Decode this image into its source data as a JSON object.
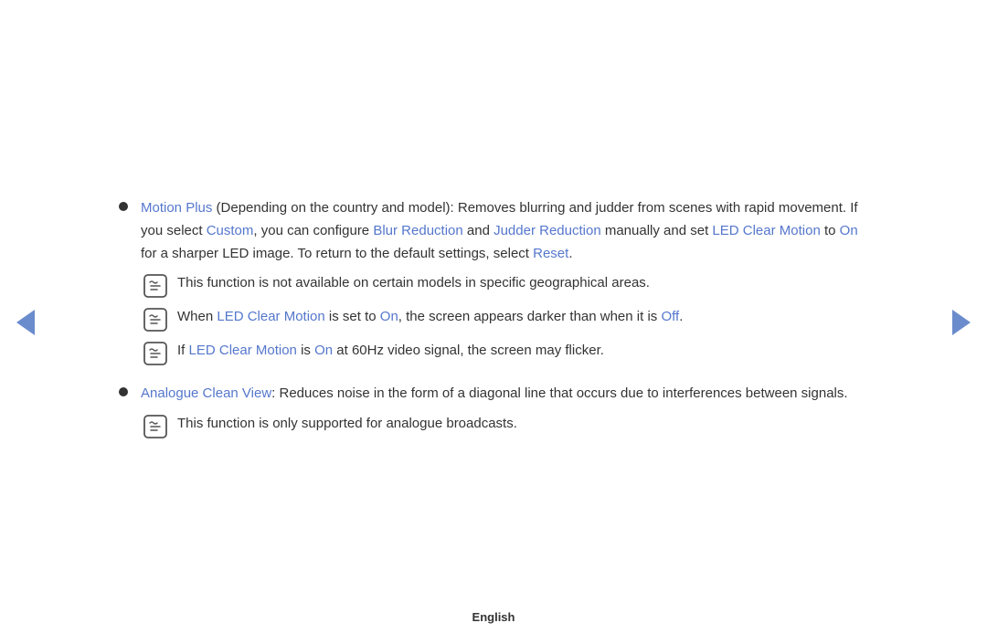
{
  "colors": {
    "link": "#5577cc",
    "text": "#333333",
    "bullet": "#333333",
    "arrow": "#6b8ccc"
  },
  "content": {
    "bullet1": {
      "term": "Motion Plus",
      "term_suffix": " (Depending on the country and model): Removes blurring and judder from scenes with rapid movement. If you select ",
      "custom": "Custom",
      "custom_suffix": ", you can configure ",
      "blur": "Blur Reduction",
      "and": " and ",
      "judder": "Judder Reduction",
      "manually": " manually and set ",
      "led": "LED Clear Motion",
      "to": " to ",
      "on": "On",
      "on_suffix": " for a sharper LED image. To return to the default settings, select ",
      "reset": "Reset",
      "reset_suffix": ".",
      "notes": [
        {
          "text": "This function is not available on certain models in specific geographical areas."
        },
        {
          "text_before": "When ",
          "led": "LED Clear Motion",
          "text_mid": " is set to ",
          "on": "On",
          "text_after": ", the screen appears darker than when it is ",
          "off": "Off",
          "text_end": "."
        },
        {
          "text_before": "If ",
          "led": "LED Clear Motion",
          "text_mid": " is ",
          "on": "On",
          "text_after": " at 60Hz video signal, the screen may flicker."
        }
      ]
    },
    "bullet2": {
      "term": "Analogue Clean View",
      "term_suffix": ": Reduces noise in the form of a diagonal line that occurs due to interferences between signals.",
      "notes": [
        {
          "text": "This function is only supported for analogue broadcasts."
        }
      ]
    }
  },
  "footer": {
    "label": "English"
  }
}
